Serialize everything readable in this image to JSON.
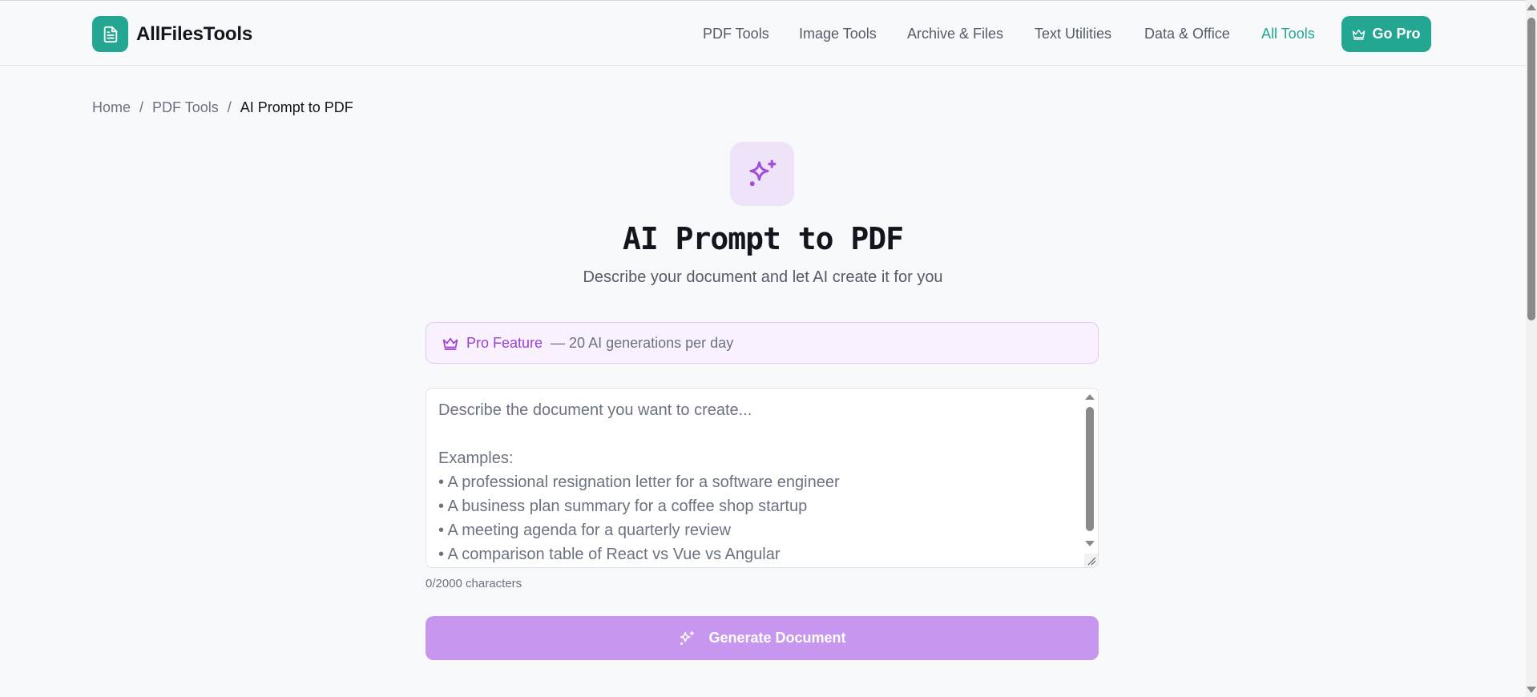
{
  "header": {
    "logo_text": "AllFilesTools",
    "nav": [
      {
        "label": "PDF Tools"
      },
      {
        "label": "Image Tools"
      },
      {
        "label": "Archive & Files"
      },
      {
        "label": "Text Utilities"
      },
      {
        "label": "Data & Office"
      },
      {
        "label": "All Tools",
        "active": true
      }
    ],
    "go_pro_label": "Go Pro"
  },
  "breadcrumb": {
    "items": [
      "Home",
      "PDF Tools"
    ],
    "separator": "/",
    "current": "AI Prompt to PDF"
  },
  "hero": {
    "icon": "sparkles-icon",
    "title": "AI Prompt to PDF",
    "subtitle": "Describe your document and let AI create it for you"
  },
  "pro_banner": {
    "icon": "crown-icon",
    "label": "Pro Feature",
    "description": "— 20 AI generations per day"
  },
  "prompt": {
    "value": "",
    "placeholder": "Describe the document you want to create...\n\nExamples:\n• A professional resignation letter for a software engineer\n• A business plan summary for a coffee shop startup\n• A meeting agenda for a quarterly review\n• A comparison table of React vs Vue vs Angular",
    "char_count": "0/2000 characters"
  },
  "generate_button": {
    "label": "Generate Document",
    "icon": "sparkles-icon"
  },
  "colors": {
    "brand": "#23a692",
    "ai_accent": "#9b3fd6",
    "generate_button_bg": "#c797ef"
  }
}
